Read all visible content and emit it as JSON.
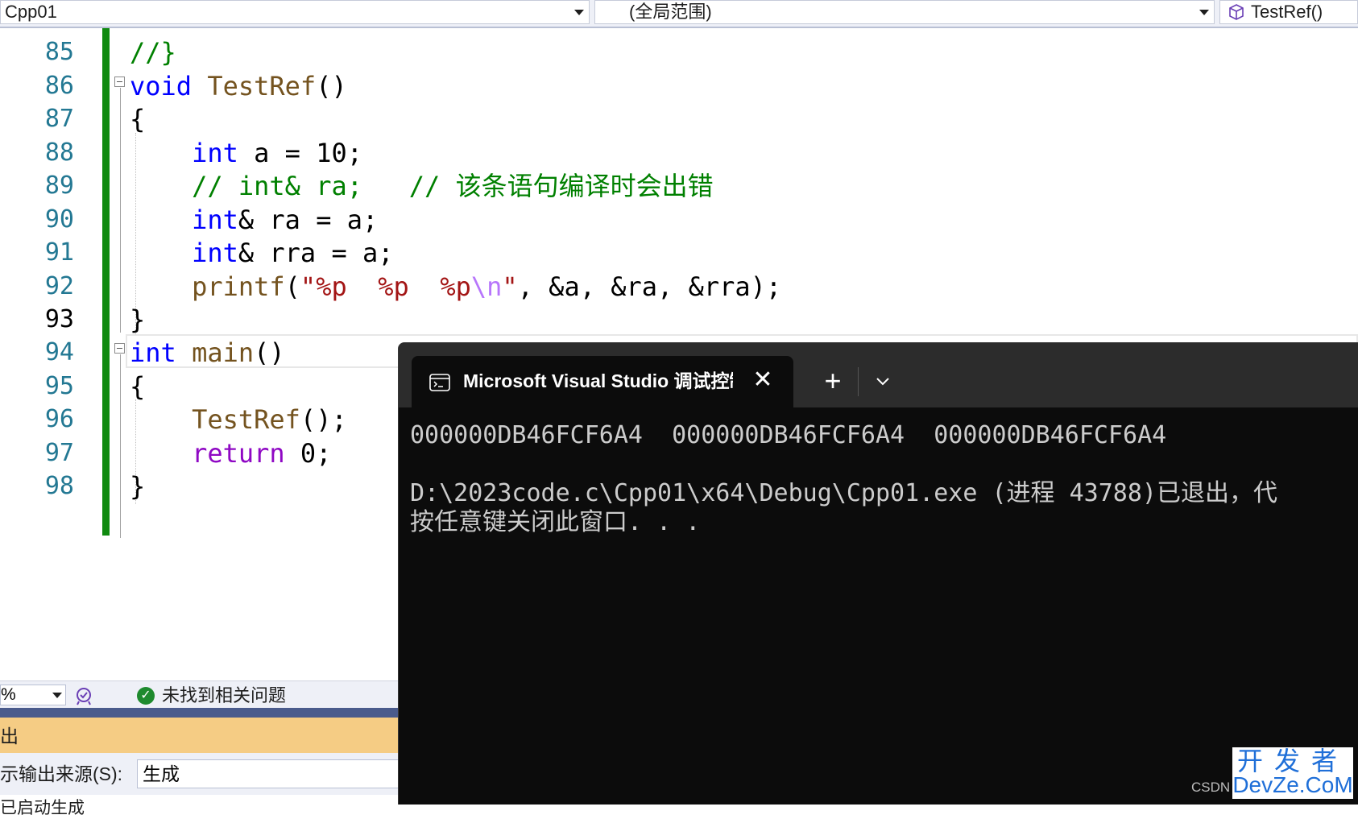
{
  "nav": {
    "project": "Cpp01",
    "scope": "(全局范围)",
    "member": "TestRef()"
  },
  "editor": {
    "current_line": "93",
    "lines": [
      {
        "num": "85",
        "code": "//}"
      },
      {
        "num": "86",
        "code": "void TestRef()"
      },
      {
        "num": "87",
        "code": "{"
      },
      {
        "num": "88",
        "code": "    int a = 10;"
      },
      {
        "num": "89",
        "code": "    // int& ra;   // 该条语句编译时会出错"
      },
      {
        "num": "90",
        "code": "    int& ra = a;"
      },
      {
        "num": "91",
        "code": "    int& rra = a;"
      },
      {
        "num": "92",
        "code": "    printf(\"%p  %p  %p\\n\", &a, &ra, &rra);"
      },
      {
        "num": "93",
        "code": "}"
      },
      {
        "num": "94",
        "code": "int main()"
      },
      {
        "num": "95",
        "code": "{"
      },
      {
        "num": "96",
        "code": "    TestRef();"
      },
      {
        "num": "97",
        "code": "    return 0;"
      },
      {
        "num": "98",
        "code": "}"
      }
    ]
  },
  "status": {
    "zoom": "%",
    "issues": "未找到相关问题"
  },
  "output": {
    "title": "出",
    "source_label": "示输出来源(S):",
    "source_value": "生成",
    "first_line": "已启动生成"
  },
  "console": {
    "tab_title": "Microsoft Visual Studio 调试控制台",
    "tab_close": "✕",
    "new_tab": "+",
    "output_line1": "000000DB46FCF6A4  000000DB46FCF6A4  000000DB46FCF6A4",
    "output_line2": "",
    "output_line3": "D:\\2023code.c\\Cpp01\\x64\\Debug\\Cpp01.exe (进程 43788)已退出，代",
    "output_line4": "按任意键关闭此窗口. . ."
  },
  "watermark": {
    "csdn": "CSDN",
    "logo_top": "开发者",
    "logo_bottom": "DevZe.CoM"
  },
  "colors": {
    "keyword": "#0000ff",
    "comment": "#008000",
    "string": "#a31515",
    "change_bar": "#108a10",
    "console_bg": "#0c0c0c",
    "output_header": "#f5cc84"
  },
  "icons": [
    "chevron-down-icon",
    "cube-icon",
    "health-icon",
    "check-icon",
    "terminal-icon",
    "close-icon",
    "plus-icon"
  ]
}
